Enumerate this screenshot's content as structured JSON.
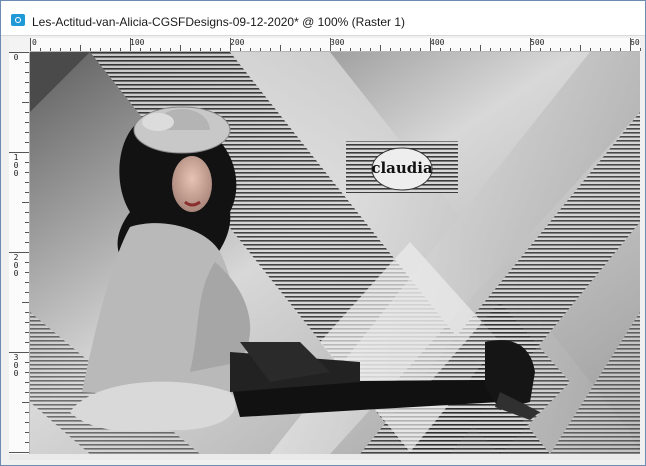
{
  "window": {
    "title": "Les-Actitud-van-Alicia-CGSFDesigns-09-12-2020* @ 100% (Raster 1)",
    "icon": "paintshop-app-icon"
  },
  "ruler": {
    "horizontal_labels": [
      "0",
      "100",
      "200",
      "300",
      "400",
      "500",
      "60"
    ],
    "vertical_labels": [
      "0",
      "1 0 0",
      "2 0 0",
      "3 0 0"
    ]
  },
  "canvas": {
    "watermark_text": "claudia",
    "colors": {
      "dark": "#1c1c1c",
      "mid": "#8c8c8c",
      "light": "#e6e6e6"
    }
  }
}
